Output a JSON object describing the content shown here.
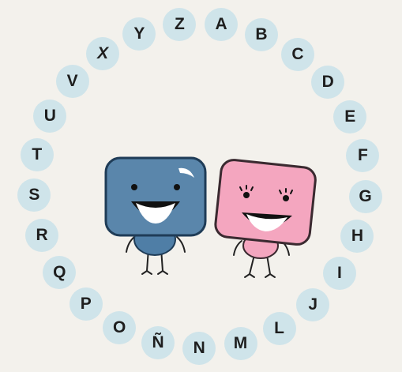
{
  "letters": [
    "Z",
    "A",
    "B",
    "C",
    "D",
    "E",
    "F",
    "G",
    "H",
    "I",
    "J",
    "L",
    "M",
    "N",
    "Ñ",
    "O",
    "P",
    "Q",
    "R",
    "S",
    "T",
    "U",
    "V",
    "X",
    "Y"
  ],
  "colors": {
    "background": "#f3f1ec",
    "bubble": "#cfe4ea",
    "letter": "#1e1e1e",
    "blue_character": "#5a86ab",
    "pink_character": "#f4a6bf"
  },
  "icons": [
    "blue-square-character",
    "pink-square-character"
  ]
}
